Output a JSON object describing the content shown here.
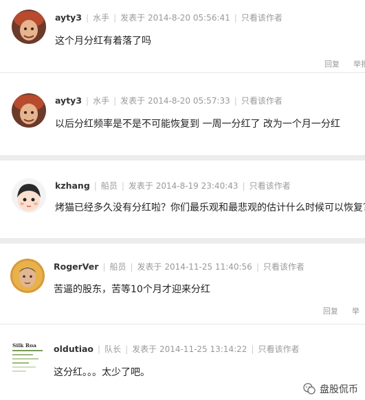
{
  "posts": [
    {
      "user": "ayty3",
      "rank": "水手",
      "time": "发表于 2014-8-20 05:56:41",
      "only_author": "只看该作者",
      "content": "这个月分红有着落了吗",
      "reply": "回复",
      "report": "举报"
    },
    {
      "user": "ayty3",
      "rank": "水手",
      "time": "发表于 2014-8-20 05:57:33",
      "only_author": "只看该作者",
      "content": "以后分红频率是不是不可能恢复到 一周一分红了 改为一个月一分红"
    },
    {
      "user": "kzhang",
      "rank": "船员",
      "time": "发表于 2014-8-19 23:40:43",
      "only_author": "只看该作者",
      "content": "烤猫已经多久没有分红啦？你们最乐观和最悲观的估计什么时候可以恢复？"
    },
    {
      "user": "RogerVer",
      "rank": "船员",
      "time": "发表于 2014-11-25 11:40:56",
      "only_author": "只看该作者",
      "content": "苦逼的股东，苦等10个月才迎来分红",
      "reply": "回复",
      "report": "举"
    },
    {
      "user": "oldutiao",
      "rank": "队长",
      "time": "发表于 2014-11-25 13:14:22",
      "only_author": "只看该作者",
      "content": "这分红。。。太少了吧。"
    }
  ],
  "avatar_labels": {
    "silk": "Silk Roa"
  },
  "watermark": "盘股侃币",
  "colors": {
    "separator": "#ececec",
    "meta": "#999999"
  }
}
